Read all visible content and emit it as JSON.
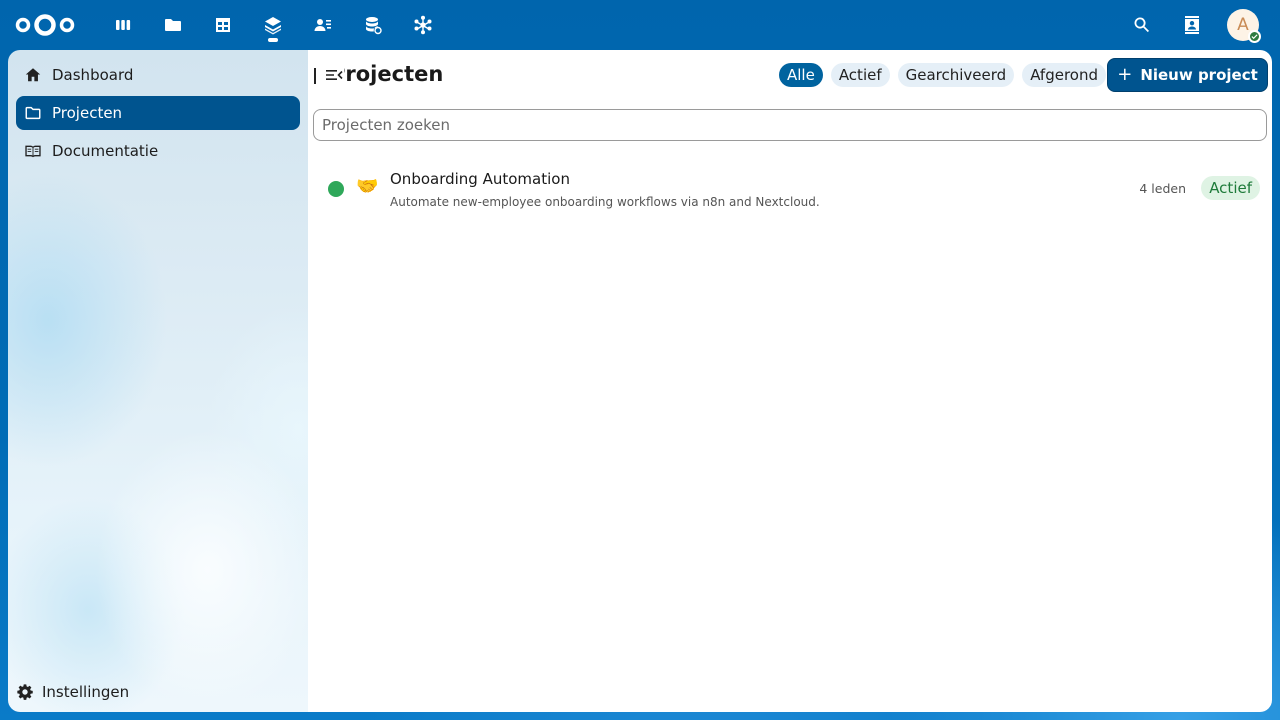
{
  "header": {
    "apps": [
      {
        "name": "deck",
        "icon": "deck-icon"
      },
      {
        "name": "files",
        "icon": "folder-icon"
      },
      {
        "name": "tables",
        "icon": "table-icon"
      },
      {
        "name": "projects",
        "icon": "layers-icon",
        "active": true
      },
      {
        "name": "contacts",
        "icon": "contacts-icon"
      },
      {
        "name": "storage",
        "icon": "database-icon"
      },
      {
        "name": "flow",
        "icon": "network-icon"
      }
    ],
    "avatar_initial": "A"
  },
  "sidebar": {
    "items": [
      {
        "label": "Dashboard",
        "icon": "home-icon"
      },
      {
        "label": "Projecten",
        "icon": "folder-outline-icon",
        "active": true
      },
      {
        "label": "Documentatie",
        "icon": "book-icon"
      }
    ],
    "settings_label": "Instellingen"
  },
  "main": {
    "title": "Projecten",
    "filters": [
      {
        "label": "Alle",
        "active": true
      },
      {
        "label": "Actief"
      },
      {
        "label": "Gearchiveerd"
      },
      {
        "label": "Afgerond"
      }
    ],
    "new_button_label": "Nieuw project",
    "search_placeholder": "Projecten zoeken",
    "projects": [
      {
        "emoji": "🤝",
        "name": "Onboarding Automation",
        "description": "Automate new-employee onboarding workflows via n8n and Nextcloud.",
        "members": "4 leden",
        "status": "Actief",
        "status_color": "#2fa85a"
      }
    ]
  },
  "colors": {
    "primary": "#00548f",
    "header_bg": "#0068b0",
    "success": "#2fa85a"
  }
}
